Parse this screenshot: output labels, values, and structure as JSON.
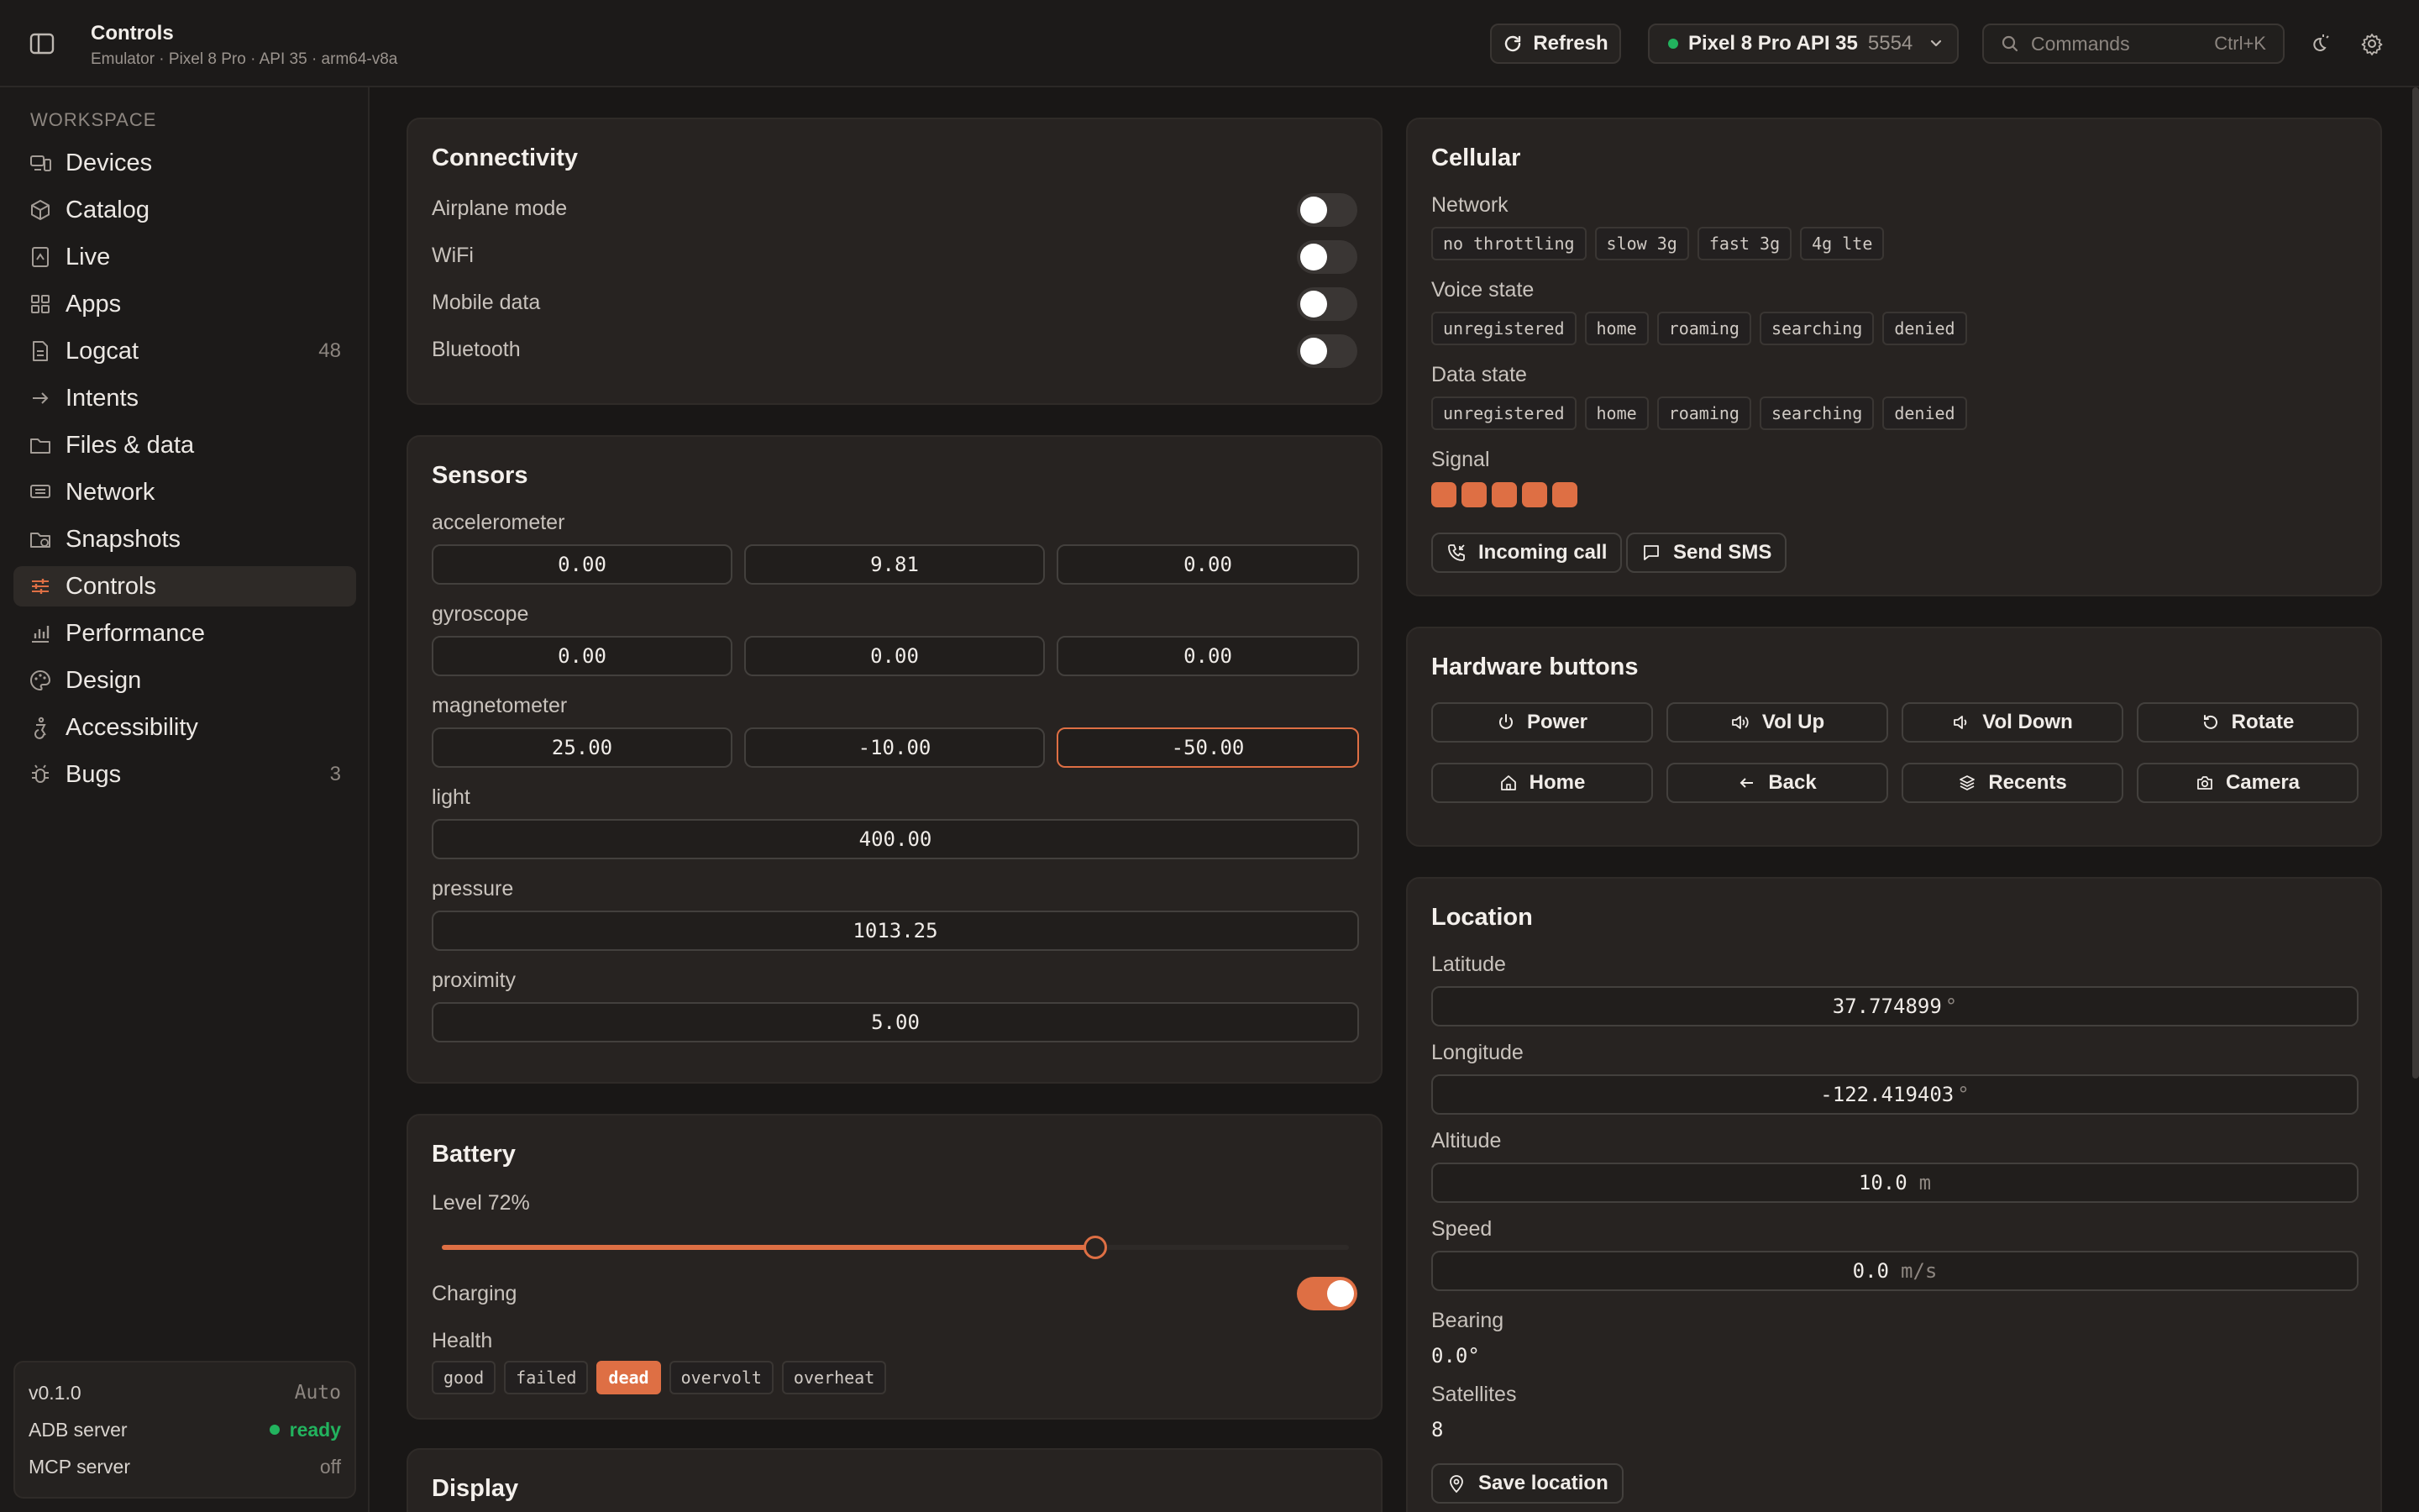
{
  "header": {
    "title": "Controls",
    "subtitle": "Emulator · Pixel 8 Pro · API 35 · arm64-v8a",
    "refresh_label": "Refresh",
    "device_name": "Pixel 8 Pro API 35",
    "device_port": "5554",
    "search_placeholder": "Commands",
    "search_shortcut": "Ctrl+K"
  },
  "sidebar": {
    "section_label": "WORKSPACE",
    "items": [
      {
        "label": "Devices",
        "icon": "devices-icon",
        "count": ""
      },
      {
        "label": "Catalog",
        "icon": "cube-icon",
        "count": ""
      },
      {
        "label": "Live",
        "icon": "live-icon",
        "count": ""
      },
      {
        "label": "Apps",
        "icon": "grid-icon",
        "count": ""
      },
      {
        "label": "Logcat",
        "icon": "file-text-icon",
        "count": "48"
      },
      {
        "label": "Intents",
        "icon": "arrow-right-icon",
        "count": ""
      },
      {
        "label": "Files & data",
        "icon": "folder-icon",
        "count": ""
      },
      {
        "label": "Network",
        "icon": "router-icon",
        "count": ""
      },
      {
        "label": "Snapshots",
        "icon": "folder-clock-icon",
        "count": ""
      },
      {
        "label": "Controls",
        "icon": "sliders-icon",
        "count": ""
      },
      {
        "label": "Performance",
        "icon": "bar-chart-icon",
        "count": ""
      },
      {
        "label": "Design",
        "icon": "palette-icon",
        "count": ""
      },
      {
        "label": "Accessibility",
        "icon": "accessibility-icon",
        "count": ""
      },
      {
        "label": "Bugs",
        "icon": "bug-icon",
        "count": "3"
      }
    ],
    "active_item": "Controls",
    "status": {
      "version": "v0.1.0",
      "theme": "Auto",
      "adb_label": "ADB server",
      "adb_value": "ready",
      "mcp_label": "MCP server",
      "mcp_value": "off"
    }
  },
  "connectivity": {
    "title": "Connectivity",
    "toggles": [
      {
        "label": "Airplane mode",
        "on": false
      },
      {
        "label": "WiFi",
        "on": false
      },
      {
        "label": "Mobile data",
        "on": false
      },
      {
        "label": "Bluetooth",
        "on": false
      }
    ]
  },
  "sensors": {
    "title": "Sensors",
    "accelerometer": {
      "label": "accelerometer",
      "x": "0.00",
      "y": "9.81",
      "z": "0.00"
    },
    "gyroscope": {
      "label": "gyroscope",
      "x": "0.00",
      "y": "0.00",
      "z": "0.00"
    },
    "magnetometer": {
      "label": "magnetometer",
      "x": "25.00",
      "y": "-10.00",
      "z": "-50.00"
    },
    "light": {
      "label": "light",
      "value": "400.00"
    },
    "pressure": {
      "label": "pressure",
      "value": "1013.25"
    },
    "proximity": {
      "label": "proximity",
      "value": "5.00"
    }
  },
  "battery": {
    "title": "Battery",
    "level_label": "Level 72%",
    "level_fraction": 0.72,
    "charging_label": "Charging",
    "charging_on": true,
    "health_label": "Health",
    "health_options": [
      "good",
      "failed",
      "dead",
      "overvolt",
      "overheat"
    ],
    "health_selected": "dead"
  },
  "display": {
    "title": "Display"
  },
  "cellular": {
    "title": "Cellular",
    "network_label": "Network",
    "network_options": [
      "no throttling",
      "slow 3g",
      "fast 3g",
      "4g lte"
    ],
    "voice_label": "Voice state",
    "voice_options": [
      "unregistered",
      "home",
      "roaming",
      "searching",
      "denied"
    ],
    "data_label": "Data state",
    "data_options": [
      "unregistered",
      "home",
      "roaming",
      "searching",
      "denied"
    ],
    "signal_label": "Signal",
    "signal_level": 5,
    "incoming_call_label": "Incoming call",
    "send_sms_label": "Send SMS"
  },
  "hardware": {
    "title": "Hardware buttons",
    "buttons": [
      {
        "label": "Power",
        "icon": "power-icon"
      },
      {
        "label": "Vol Up",
        "icon": "volume-up-icon"
      },
      {
        "label": "Vol Down",
        "icon": "volume-down-icon"
      },
      {
        "label": "Rotate",
        "icon": "rotate-icon"
      },
      {
        "label": "Home",
        "icon": "home-icon"
      },
      {
        "label": "Back",
        "icon": "arrow-left-icon"
      },
      {
        "label": "Recents",
        "icon": "layers-icon"
      },
      {
        "label": "Camera",
        "icon": "camera-icon"
      }
    ]
  },
  "location": {
    "title": "Location",
    "latitude_label": "Latitude",
    "latitude": "37.774899",
    "latitude_unit": "°",
    "longitude_label": "Longitude",
    "longitude": "-122.419403",
    "longitude_unit": "°",
    "altitude_label": "Altitude",
    "altitude": "10.0",
    "altitude_unit": "m",
    "speed_label": "Speed",
    "speed": "0.0",
    "speed_unit": "m/s",
    "bearing_label": "Bearing",
    "bearing": "0.0°",
    "satellites_label": "Satellites",
    "satellites": "8",
    "save_label": "Save location"
  },
  "colors": {
    "accent": "#de6f44",
    "background": "#191716",
    "card": "#272321",
    "ready_green": "#22b35e"
  }
}
